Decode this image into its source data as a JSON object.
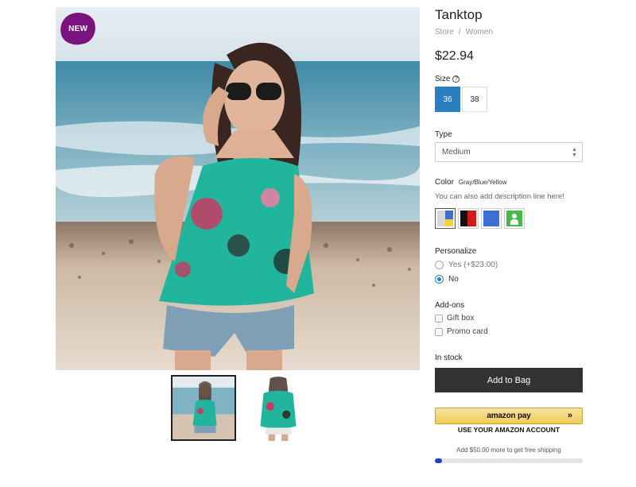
{
  "badge": {
    "label": "NEW"
  },
  "product": {
    "title": "Tanktop",
    "breadcrumb": [
      "Store",
      "Women"
    ],
    "breadcrumb_sep": "/",
    "price": "$22.94"
  },
  "size": {
    "label": "Size",
    "help_icon": "?",
    "options": [
      "36",
      "38"
    ],
    "selected": "36"
  },
  "type": {
    "label": "Type",
    "value": "Medium"
  },
  "color": {
    "label": "Color",
    "value": "Gray/Blue/Yellow",
    "description": "You can also add description line here!",
    "swatches": [
      "gray-blue-yellow",
      "black-red",
      "blue",
      "green-figure"
    ]
  },
  "personalize": {
    "label": "Personalize",
    "options": [
      "Yes (+$23.00)",
      "No"
    ],
    "selected": "No"
  },
  "addons": {
    "label": "Add-ons",
    "options": [
      "Gift box",
      "Promo card"
    ]
  },
  "stock": {
    "label": "In stock"
  },
  "cart": {
    "add_label": "Add to Bag"
  },
  "amazon": {
    "label": "amazon pay",
    "arrow": "»",
    "subtitle": "USE YOUR AMAZON ACCOUNT"
  },
  "shipping": {
    "text": "Add $50.00 more to get free shipping",
    "progress_fraction": 0.05
  },
  "colors": {
    "accent": "#2a7fc1",
    "badge": "#7b137e",
    "button_dark": "#333333",
    "progress": "#1a3fd6"
  }
}
